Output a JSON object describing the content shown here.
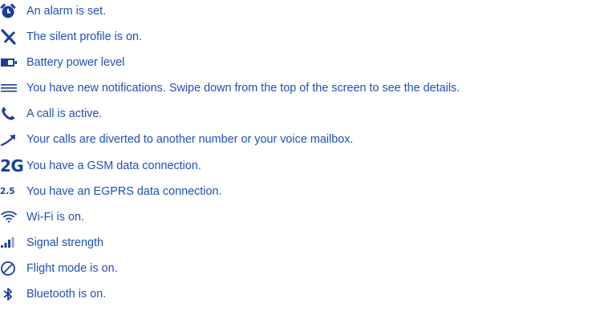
{
  "icon_color": "#1a3f9a",
  "text_color": "#1f4fb8",
  "items": [
    {
      "icon": "alarm-clock-icon",
      "text": "An alarm is set."
    },
    {
      "icon": "silent-profile-icon",
      "text": "The silent profile is on."
    },
    {
      "icon": "battery-icon",
      "text": "Battery power level"
    },
    {
      "icon": "notifications-icon",
      "text": "You have new notifications. Swipe down from the top of the screen to see the details."
    },
    {
      "icon": "phone-call-icon",
      "text": "A call is active."
    },
    {
      "icon": "call-divert-icon",
      "text": "Your calls are diverted to another number or your voice mailbox."
    },
    {
      "icon": "gsm-2g-icon",
      "icon_label": "2G",
      "text": "You have a GSM data connection."
    },
    {
      "icon": "egprs-icon",
      "icon_label": "2.5",
      "text": "You have an EGPRS data connection."
    },
    {
      "icon": "wifi-icon",
      "text": "Wi-Fi is on."
    },
    {
      "icon": "signal-strength-icon",
      "text": "Signal strength"
    },
    {
      "icon": "flight-mode-icon",
      "text": "Flight mode is on."
    },
    {
      "icon": "bluetooth-icon",
      "text": "Bluetooth is on."
    }
  ]
}
